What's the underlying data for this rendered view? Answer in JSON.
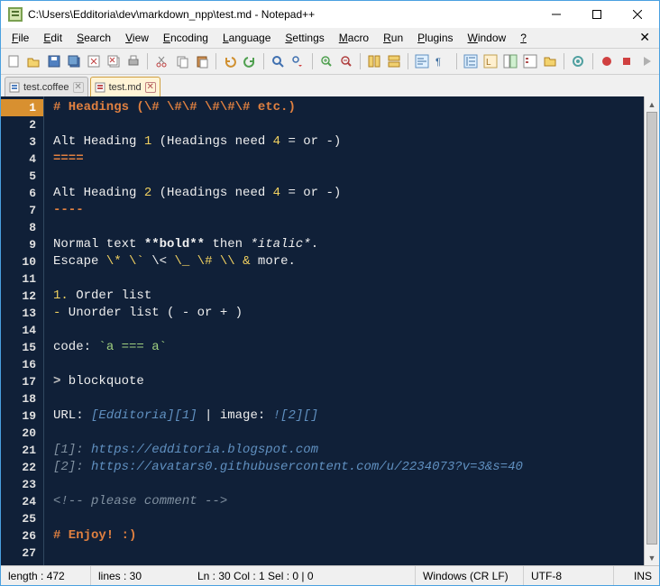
{
  "title": "C:\\Users\\Edditoria\\dev\\markdown_npp\\test.md - Notepad++",
  "menus": [
    "File",
    "Edit",
    "Search",
    "View",
    "Encoding",
    "Language",
    "Settings",
    "Macro",
    "Run",
    "Plugins",
    "Window",
    "?"
  ],
  "tabs": [
    {
      "label": "test.coffee",
      "active": false
    },
    {
      "label": "test.md",
      "active": true
    }
  ],
  "line_numbers": [
    "1",
    "2",
    "3",
    "4",
    "5",
    "6",
    "7",
    "8",
    "9",
    "10",
    "11",
    "12",
    "13",
    "14",
    "15",
    "16",
    "17",
    "18",
    "19",
    "20",
    "21",
    "22",
    "23",
    "24",
    "25",
    "26",
    "27"
  ],
  "code": [
    {
      "t": "heading",
      "text": "# Headings (\\# \\#\\# \\#\\#\\# etc.)"
    },
    {
      "t": "blank",
      "text": ""
    },
    {
      "t": "alt1",
      "text": "Alt Heading 1 (Headings need 4 = or -)"
    },
    {
      "t": "rule-eq",
      "text": "===="
    },
    {
      "t": "blank",
      "text": ""
    },
    {
      "t": "alt2",
      "text": "Alt Heading 2 (Headings need 4 = or -)"
    },
    {
      "t": "rule-dash",
      "text": "----"
    },
    {
      "t": "blank",
      "text": ""
    },
    {
      "t": "normal",
      "text": "Normal text **bold** then *italic*."
    },
    {
      "t": "escape",
      "text": "Escape \\* \\` \\< \\_ \\# \\\\ & more."
    },
    {
      "t": "blank",
      "text": ""
    },
    {
      "t": "list",
      "text": "1. Order list"
    },
    {
      "t": "list",
      "text": "- Unorder list ( - or + )"
    },
    {
      "t": "blank",
      "text": ""
    },
    {
      "t": "codeinline",
      "text": "code: `a === a`"
    },
    {
      "t": "blank",
      "text": ""
    },
    {
      "t": "blockquote",
      "text": "> blockquote"
    },
    {
      "t": "blank",
      "text": ""
    },
    {
      "t": "url",
      "text": "URL: [Edditoria][1] | image: ![2][]"
    },
    {
      "t": "blank",
      "text": ""
    },
    {
      "t": "ref",
      "text": "[1]: https://edditoria.blogspot.com"
    },
    {
      "t": "ref",
      "text": "[2]: https://avatars0.githubusercontent.com/u/2234073?v=3&s=40"
    },
    {
      "t": "blank",
      "text": ""
    },
    {
      "t": "comment",
      "text": "<!-- please comment -->"
    },
    {
      "t": "blank",
      "text": ""
    },
    {
      "t": "heading",
      "text": "# Enjoy! :)"
    },
    {
      "t": "blank",
      "text": ""
    }
  ],
  "status": {
    "length": "length : 472",
    "lines": "lines : 30",
    "pos": "Ln : 30   Col : 1   Sel : 0 | 0",
    "eol": "Windows (CR LF)",
    "enc": "UTF-8",
    "ins": "INS"
  }
}
